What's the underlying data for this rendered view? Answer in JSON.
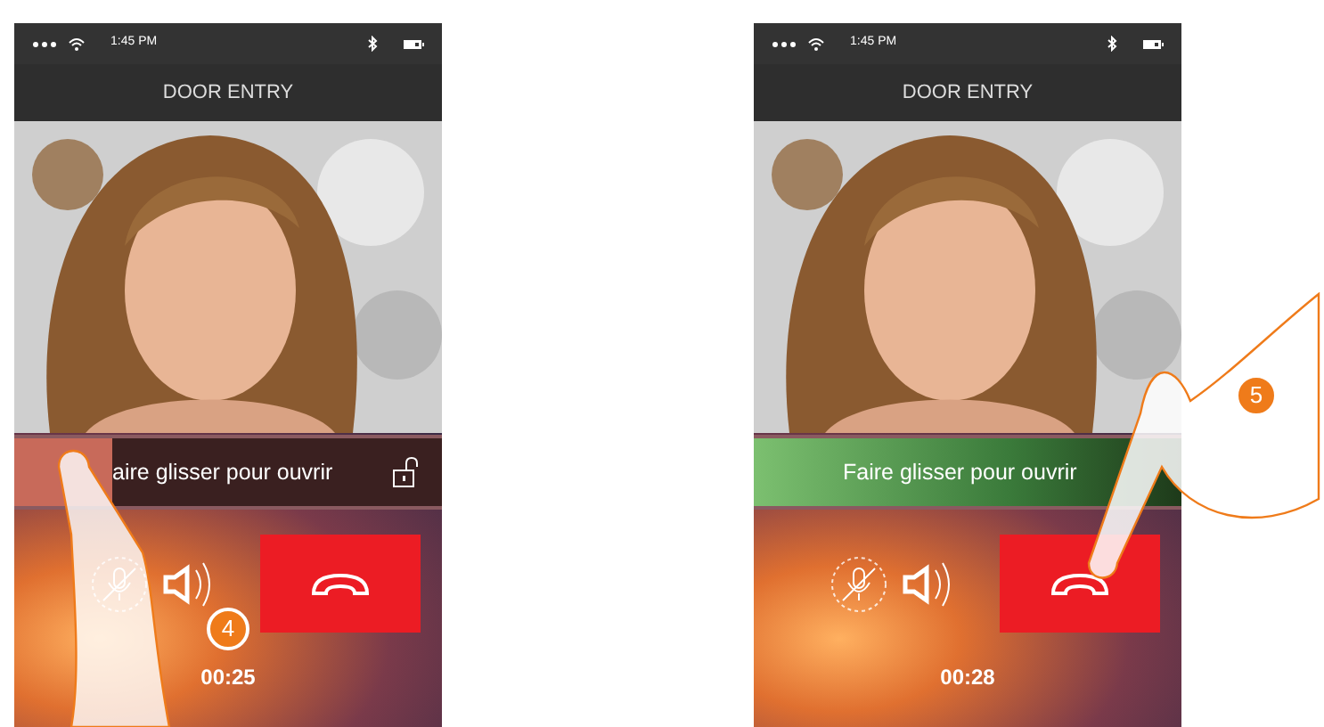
{
  "screens": [
    {
      "status_bar": {
        "time": "1:45 PM"
      },
      "title": "DOOR ENTRY",
      "slider": {
        "text": "aire glisser pour ouvrir",
        "level": 0.23,
        "unlocked": false,
        "lock_icon": true
      },
      "microphone_muted": true,
      "timer": "00:25",
      "step": "4",
      "kind": "swipe"
    },
    {
      "status_bar": {
        "time": "1:45 PM"
      },
      "title": "DOOR ENTRY",
      "slider": {
        "text": "Faire glisser pour ouvrir",
        "level": 1,
        "unlocked": true,
        "lock_icon": false
      },
      "microphone_muted": true,
      "timer": "00:28",
      "step": "5",
      "kind": "tap"
    }
  ]
}
